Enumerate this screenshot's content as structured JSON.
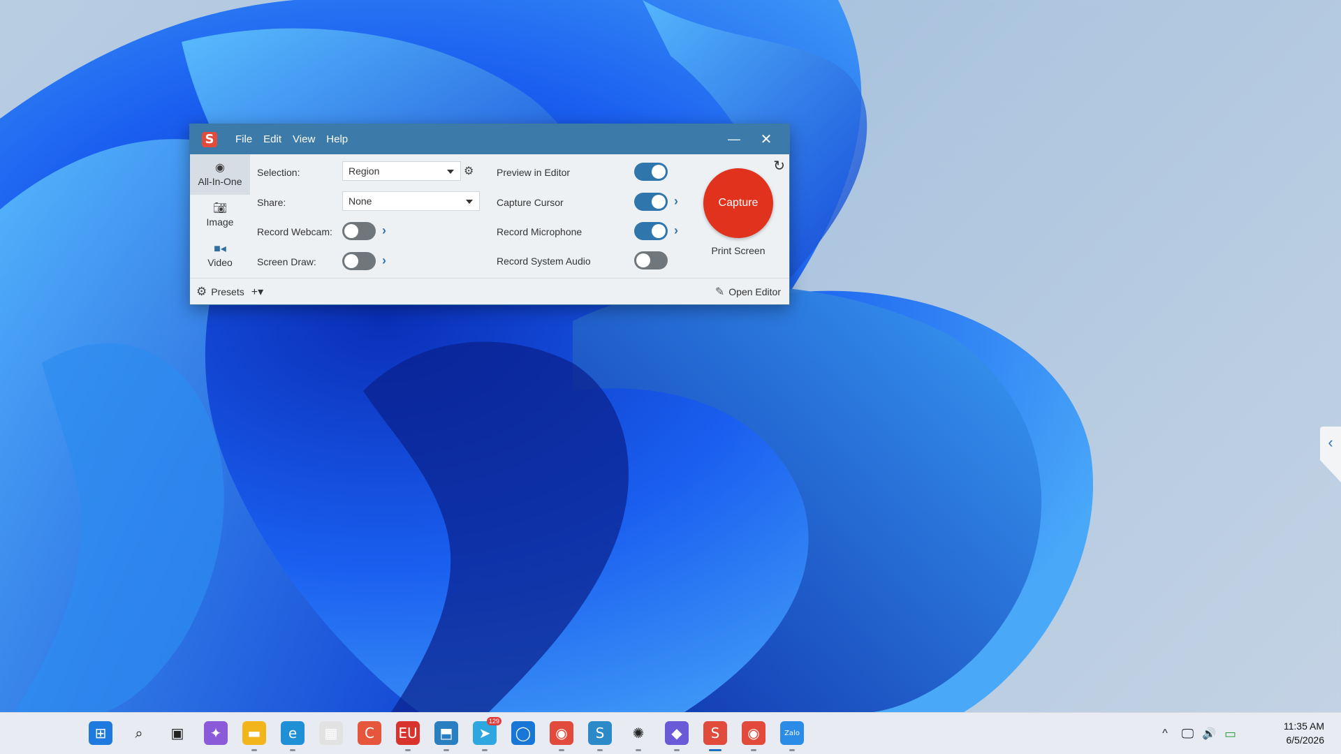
{
  "app": {
    "logo": "S",
    "menu": [
      "File",
      "Edit",
      "View",
      "Help"
    ],
    "minimize_glyph": "—",
    "close_glyph": "✕"
  },
  "modes": [
    {
      "label": "All-In-One",
      "icon": "record-circle-icon",
      "active": true
    },
    {
      "label": "Image",
      "icon": "camera-icon",
      "active": false
    },
    {
      "label": "Video",
      "icon": "video-camera-icon",
      "active": false
    }
  ],
  "settings": {
    "selection_label": "Selection:",
    "selection_value": "Region",
    "share_label": "Share:",
    "share_value": "None",
    "webcam_label": "Record Webcam:",
    "webcam_on": false,
    "screen_draw_label": "Screen Draw:",
    "screen_draw_on": false,
    "preview_label": "Preview in Editor",
    "preview_on": true,
    "cursor_label": "Capture Cursor",
    "cursor_on": true,
    "mic_label": "Record Microphone",
    "mic_on": true,
    "system_audio_label": "Record System Audio",
    "system_audio_on": false
  },
  "capture": {
    "button_label": "Capture",
    "hotkey": "Print Screen"
  },
  "footer": {
    "presets_label": "Presets",
    "add_label": "+▾",
    "open_editor_label": "Open Editor"
  },
  "side_tab": {
    "glyph": "‹"
  },
  "taskbar": {
    "icons": [
      {
        "name": "start-icon",
        "glyph": "⊞",
        "bg": "#1f7ae0"
      },
      {
        "name": "search-icon",
        "glyph": "⌕",
        "bg": "transparent"
      },
      {
        "name": "task-view-icon",
        "glyph": "▣",
        "bg": "transparent"
      },
      {
        "name": "copilot-icon",
        "glyph": "✦",
        "bg": "#8a5ad8"
      },
      {
        "name": "file-explorer-icon",
        "glyph": "▬",
        "bg": "#f2b61c"
      },
      {
        "name": "edge-icon",
        "glyph": "e",
        "bg": "#1f8fd6"
      },
      {
        "name": "store-icon",
        "glyph": "▦",
        "bg": "#e2e2e2"
      },
      {
        "name": "camtasia-icon",
        "glyph": "C",
        "bg": "#e5563d"
      },
      {
        "name": "calendar-icon",
        "glyph": "EU",
        "bg": "#d8332c"
      },
      {
        "name": "remote-desktop-icon",
        "glyph": "⬒",
        "bg": "#2a7fc0"
      },
      {
        "name": "telegram-icon",
        "glyph": "➤",
        "bg": "#2ea6e0"
      },
      {
        "name": "browser-icon",
        "glyph": "◯",
        "bg": "#1877d6"
      },
      {
        "name": "chrome-icon",
        "glyph": "◉",
        "bg": "#e24a3b"
      },
      {
        "name": "snagit-blue-icon",
        "glyph": "S",
        "bg": "#2c8ac8"
      },
      {
        "name": "claude-icon",
        "glyph": "✺",
        "bg": "transparent"
      },
      {
        "name": "chat-icon",
        "glyph": "◆",
        "bg": "#6b5ad8"
      },
      {
        "name": "snagit-icon",
        "glyph": "S",
        "bg": "#e14b3b"
      },
      {
        "name": "chrome-profile-icon",
        "glyph": "◉",
        "bg": "#e24a3b"
      },
      {
        "name": "zalo-icon",
        "glyph": "Zalo",
        "bg": "#2a8ce6"
      }
    ],
    "telegram_badge": "129",
    "clock_time": "11:35 AM",
    "clock_date": "6/5/2026",
    "tray": {
      "chevron": "^",
      "network": "🖵",
      "volume": "🔊",
      "battery": "▭"
    }
  }
}
